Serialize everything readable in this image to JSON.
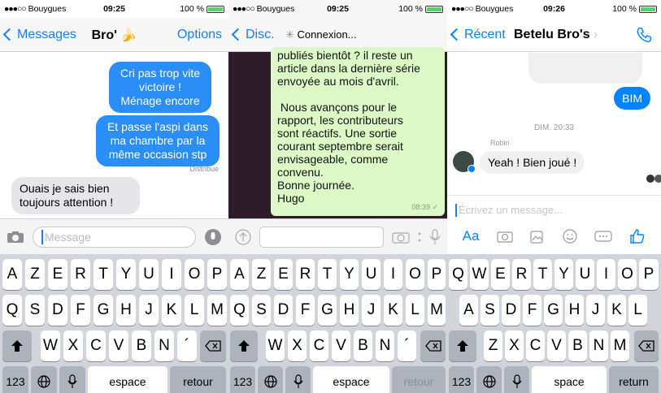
{
  "panel1": {
    "status": {
      "carrier": "Bouygues",
      "time": "09:25",
      "battery": "100 %"
    },
    "nav": {
      "back": "Messages",
      "title": "Bro' 🍌",
      "action": "Options"
    },
    "messages": [
      {
        "text": "Cri pas trop vite victoire ! Ménage encore"
      },
      {
        "text": "Et passe l'aspi dans ma chambre par la même occasion stp"
      },
      {
        "text": "Ouais je sais bien toujours attention !"
      }
    ],
    "delivered": "Distribué",
    "input_placeholder": "Message",
    "keyboard": {
      "row1": [
        "A",
        "Z",
        "E",
        "R",
        "T",
        "Y",
        "U",
        "I",
        "O",
        "P"
      ],
      "row2": [
        "Q",
        "S",
        "D",
        "F",
        "G",
        "H",
        "J",
        "K",
        "L",
        "M"
      ],
      "row3": [
        "W",
        "X",
        "C",
        "V",
        "B",
        "N",
        "´"
      ],
      "num": "123",
      "space": "espace",
      "return": "retour"
    }
  },
  "panel2": {
    "status": {
      "carrier": "Bouygues",
      "time": "09:25",
      "battery": "100 %"
    },
    "nav": {
      "back": "Disc.",
      "title": "Connexion..."
    },
    "message": {
      "text_lines": [
        "publiés bientôt ? il reste un",
        "article dans la dernière série",
        "envoyée au mois d'avril.",
        "",
        " Nous avançons pour le",
        "rapport, les contributeurs",
        "sont réactifs. Une sortie",
        "courant septembre serait",
        "envisageable, comme",
        "convenu.",
        "Bonne journée.",
        "Hugo"
      ],
      "time": "08:39 ✓"
    },
    "keyboard": {
      "row1": [
        "A",
        "Z",
        "E",
        "R",
        "T",
        "Y",
        "U",
        "I",
        "O",
        "P"
      ],
      "row2": [
        "Q",
        "S",
        "D",
        "F",
        "G",
        "H",
        "J",
        "K",
        "L",
        "M"
      ],
      "row3": [
        "W",
        "X",
        "C",
        "V",
        "B",
        "N",
        "´"
      ],
      "num": "123",
      "space": "espace",
      "return": "retour"
    }
  },
  "panel3": {
    "status": {
      "carrier": "Bouygues",
      "time": "09:26",
      "battery": "100 %"
    },
    "nav": {
      "back": "Récent",
      "title": "Betelu Bro's"
    },
    "sent": "BIM",
    "timestamp": "DIM. 20:33",
    "sender": "Robin",
    "received": "Yeah ! Bien joué !",
    "input_placeholder": "Écrivez un message...",
    "aa": "Aa",
    "keyboard": {
      "row1": [
        "Q",
        "W",
        "E",
        "R",
        "T",
        "Y",
        "U",
        "I",
        "O",
        "P"
      ],
      "row2": [
        "A",
        "S",
        "D",
        "F",
        "G",
        "H",
        "J",
        "K",
        "L"
      ],
      "row3": [
        "Z",
        "X",
        "C",
        "V",
        "B",
        "N",
        "M"
      ],
      "num": "123",
      "space": "space",
      "return": "return"
    }
  }
}
